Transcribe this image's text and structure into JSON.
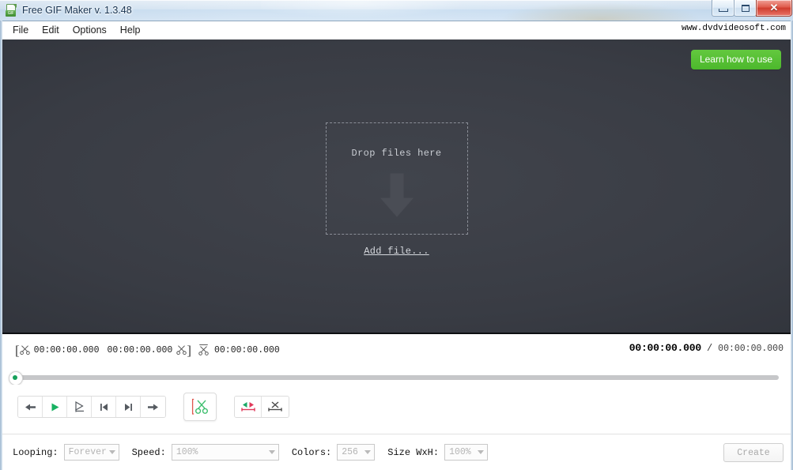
{
  "window": {
    "title": "Free GIF Maker v. 1.3.48",
    "app_icon": "gif-file-icon",
    "icon_badge": "GIF",
    "controls": {
      "minimize": "minimize-button",
      "maximize": "maximize-button",
      "close": "✕"
    }
  },
  "menubar": {
    "items": [
      {
        "label": "File"
      },
      {
        "label": "Edit"
      },
      {
        "label": "Options"
      },
      {
        "label": "Help"
      }
    ],
    "site_url": "www.dvdvideosoft.com"
  },
  "preview": {
    "learn_button": "Learn how to use",
    "drop_text": "Drop files here",
    "add_file_link": "Add file...",
    "arrow_icon": "down-arrow-icon",
    "background_color": "#393c44"
  },
  "timeline": {
    "trim_start": "00:00:00.000",
    "trim_end": "00:00:00.000",
    "selection_duration": "00:00:00.000",
    "current_time": "00:00:00.000",
    "time_separator": "/",
    "total_time": "00:00:00.000",
    "icons": {
      "trim_in": "scissors-left-icon",
      "trim_out": "scissors-right-icon",
      "selection": "scissors-span-icon"
    }
  },
  "scrubber": {
    "position_percent": 0,
    "handle_color": "#16a05a",
    "track_color": "#c6c7c9"
  },
  "transport": {
    "buttons": [
      {
        "name": "step-back-button",
        "icon": "arrow-left-icon"
      },
      {
        "name": "play-button",
        "icon": "play-icon"
      },
      {
        "name": "play-to-marker-button",
        "icon": "play-to-end-icon"
      },
      {
        "name": "previous-frame-button",
        "icon": "skip-previous-icon"
      },
      {
        "name": "next-frame-button",
        "icon": "skip-next-icon"
      },
      {
        "name": "step-forward-button",
        "icon": "arrow-right-icon"
      }
    ],
    "cut_button": {
      "name": "cut-button",
      "icon": "scissors-icon"
    },
    "marker_buttons": [
      {
        "name": "invert-selection-button",
        "icon": "invert-selection-icon"
      },
      {
        "name": "delete-selection-button",
        "icon": "delete-selection-icon"
      }
    ]
  },
  "settings": {
    "looping": {
      "label": "Looping:",
      "value": "Forever"
    },
    "speed": {
      "label": "Speed:",
      "value": "100%"
    },
    "colors": {
      "label": "Colors:",
      "value": "256"
    },
    "size": {
      "label": "Size WxH:",
      "value": "100%"
    },
    "create_button": "Create",
    "disabled": true
  }
}
